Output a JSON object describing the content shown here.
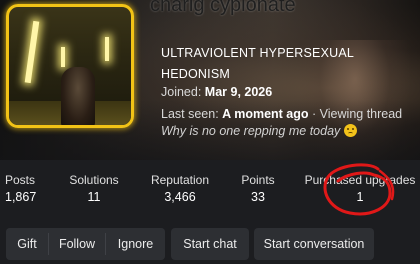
{
  "profile": {
    "username": "charig cypionate",
    "user_title": "ULTRAVIOLENT HYPERSEXUAL HEDONISM",
    "joined_label": "Joined:",
    "joined_date": "Mar 9, 2026",
    "last_seen_label": "Last seen:",
    "last_seen_value": "A moment ago",
    "separator": "·",
    "last_seen_activity": "Viewing thread",
    "status": "Why is no one repping me today",
    "avatar_border_color": "#f2c316",
    "status_emoji_icon": "sad-face-emoji-icon"
  },
  "stats": [
    {
      "label": "Posts",
      "value": "1,867"
    },
    {
      "label": "Solutions",
      "value": "11"
    },
    {
      "label": "Reputation",
      "value": "3,466"
    },
    {
      "label": "Points",
      "value": "33"
    },
    {
      "label": "Purchased upgrades",
      "value": "1"
    }
  ],
  "annotation": {
    "color": "#e01818",
    "shape": "red-circle-scribble"
  },
  "actions": {
    "gift": "Gift",
    "follow": "Follow",
    "ignore": "Ignore",
    "start_chat": "Start chat",
    "start_conversation": "Start conversation"
  }
}
